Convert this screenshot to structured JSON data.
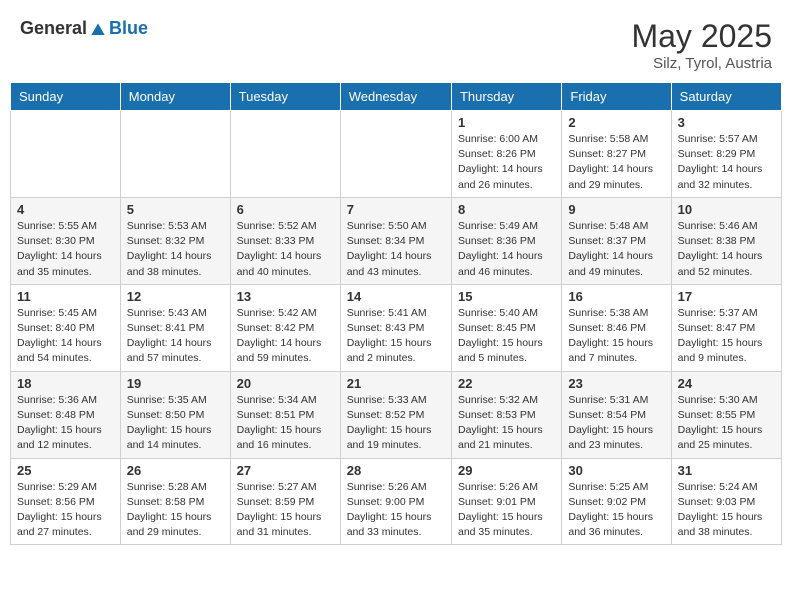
{
  "header": {
    "logo_general": "General",
    "logo_blue": "Blue",
    "month_year": "May 2025",
    "location": "Silz, Tyrol, Austria"
  },
  "weekdays": [
    "Sunday",
    "Monday",
    "Tuesday",
    "Wednesday",
    "Thursday",
    "Friday",
    "Saturday"
  ],
  "weeks": [
    [
      {
        "day": "",
        "info": ""
      },
      {
        "day": "",
        "info": ""
      },
      {
        "day": "",
        "info": ""
      },
      {
        "day": "",
        "info": ""
      },
      {
        "day": "1",
        "info": "Sunrise: 6:00 AM\nSunset: 8:26 PM\nDaylight: 14 hours\nand 26 minutes."
      },
      {
        "day": "2",
        "info": "Sunrise: 5:58 AM\nSunset: 8:27 PM\nDaylight: 14 hours\nand 29 minutes."
      },
      {
        "day": "3",
        "info": "Sunrise: 5:57 AM\nSunset: 8:29 PM\nDaylight: 14 hours\nand 32 minutes."
      }
    ],
    [
      {
        "day": "4",
        "info": "Sunrise: 5:55 AM\nSunset: 8:30 PM\nDaylight: 14 hours\nand 35 minutes."
      },
      {
        "day": "5",
        "info": "Sunrise: 5:53 AM\nSunset: 8:32 PM\nDaylight: 14 hours\nand 38 minutes."
      },
      {
        "day": "6",
        "info": "Sunrise: 5:52 AM\nSunset: 8:33 PM\nDaylight: 14 hours\nand 40 minutes."
      },
      {
        "day": "7",
        "info": "Sunrise: 5:50 AM\nSunset: 8:34 PM\nDaylight: 14 hours\nand 43 minutes."
      },
      {
        "day": "8",
        "info": "Sunrise: 5:49 AM\nSunset: 8:36 PM\nDaylight: 14 hours\nand 46 minutes."
      },
      {
        "day": "9",
        "info": "Sunrise: 5:48 AM\nSunset: 8:37 PM\nDaylight: 14 hours\nand 49 minutes."
      },
      {
        "day": "10",
        "info": "Sunrise: 5:46 AM\nSunset: 8:38 PM\nDaylight: 14 hours\nand 52 minutes."
      }
    ],
    [
      {
        "day": "11",
        "info": "Sunrise: 5:45 AM\nSunset: 8:40 PM\nDaylight: 14 hours\nand 54 minutes."
      },
      {
        "day": "12",
        "info": "Sunrise: 5:43 AM\nSunset: 8:41 PM\nDaylight: 14 hours\nand 57 minutes."
      },
      {
        "day": "13",
        "info": "Sunrise: 5:42 AM\nSunset: 8:42 PM\nDaylight: 14 hours\nand 59 minutes."
      },
      {
        "day": "14",
        "info": "Sunrise: 5:41 AM\nSunset: 8:43 PM\nDaylight: 15 hours\nand 2 minutes."
      },
      {
        "day": "15",
        "info": "Sunrise: 5:40 AM\nSunset: 8:45 PM\nDaylight: 15 hours\nand 5 minutes."
      },
      {
        "day": "16",
        "info": "Sunrise: 5:38 AM\nSunset: 8:46 PM\nDaylight: 15 hours\nand 7 minutes."
      },
      {
        "day": "17",
        "info": "Sunrise: 5:37 AM\nSunset: 8:47 PM\nDaylight: 15 hours\nand 9 minutes."
      }
    ],
    [
      {
        "day": "18",
        "info": "Sunrise: 5:36 AM\nSunset: 8:48 PM\nDaylight: 15 hours\nand 12 minutes."
      },
      {
        "day": "19",
        "info": "Sunrise: 5:35 AM\nSunset: 8:50 PM\nDaylight: 15 hours\nand 14 minutes."
      },
      {
        "day": "20",
        "info": "Sunrise: 5:34 AM\nSunset: 8:51 PM\nDaylight: 15 hours\nand 16 minutes."
      },
      {
        "day": "21",
        "info": "Sunrise: 5:33 AM\nSunset: 8:52 PM\nDaylight: 15 hours\nand 19 minutes."
      },
      {
        "day": "22",
        "info": "Sunrise: 5:32 AM\nSunset: 8:53 PM\nDaylight: 15 hours\nand 21 minutes."
      },
      {
        "day": "23",
        "info": "Sunrise: 5:31 AM\nSunset: 8:54 PM\nDaylight: 15 hours\nand 23 minutes."
      },
      {
        "day": "24",
        "info": "Sunrise: 5:30 AM\nSunset: 8:55 PM\nDaylight: 15 hours\nand 25 minutes."
      }
    ],
    [
      {
        "day": "25",
        "info": "Sunrise: 5:29 AM\nSunset: 8:56 PM\nDaylight: 15 hours\nand 27 minutes."
      },
      {
        "day": "26",
        "info": "Sunrise: 5:28 AM\nSunset: 8:58 PM\nDaylight: 15 hours\nand 29 minutes."
      },
      {
        "day": "27",
        "info": "Sunrise: 5:27 AM\nSunset: 8:59 PM\nDaylight: 15 hours\nand 31 minutes."
      },
      {
        "day": "28",
        "info": "Sunrise: 5:26 AM\nSunset: 9:00 PM\nDaylight: 15 hours\nand 33 minutes."
      },
      {
        "day": "29",
        "info": "Sunrise: 5:26 AM\nSunset: 9:01 PM\nDaylight: 15 hours\nand 35 minutes."
      },
      {
        "day": "30",
        "info": "Sunrise: 5:25 AM\nSunset: 9:02 PM\nDaylight: 15 hours\nand 36 minutes."
      },
      {
        "day": "31",
        "info": "Sunrise: 5:24 AM\nSunset: 9:03 PM\nDaylight: 15 hours\nand 38 minutes."
      }
    ]
  ]
}
